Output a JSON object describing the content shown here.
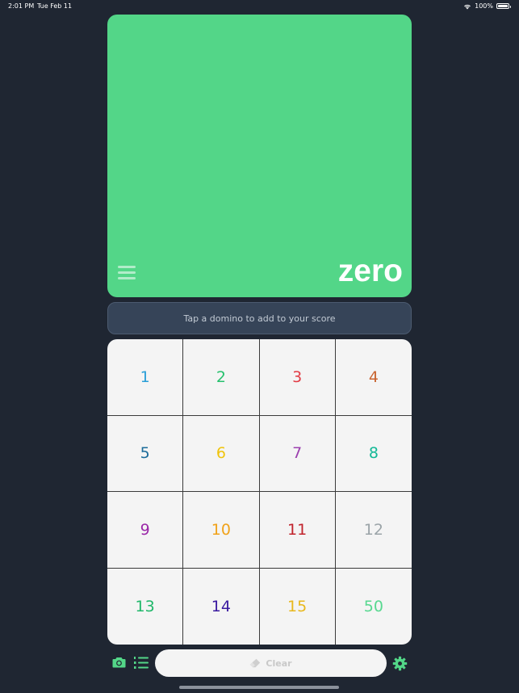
{
  "status_bar": {
    "time": "2:01 PM",
    "date": "Tue Feb 11",
    "battery": "100%"
  },
  "score_card": {
    "score": "zero",
    "background_color": "#53d688"
  },
  "hint": {
    "text": "Tap a domino to add to your score"
  },
  "dominoes": [
    {
      "label": "1",
      "color": "#2a9fd8"
    },
    {
      "label": "2",
      "color": "#27c16e"
    },
    {
      "label": "3",
      "color": "#e23c45"
    },
    {
      "label": "4",
      "color": "#c9632f"
    },
    {
      "label": "5",
      "color": "#1c6c9a"
    },
    {
      "label": "6",
      "color": "#f0c40c"
    },
    {
      "label": "7",
      "color": "#9b3fae"
    },
    {
      "label": "8",
      "color": "#12b896"
    },
    {
      "label": "9",
      "color": "#9a27a8"
    },
    {
      "label": "10",
      "color": "#f0a21a"
    },
    {
      "label": "11",
      "color": "#c1232c"
    },
    {
      "label": "12",
      "color": "#9ba4a8"
    },
    {
      "label": "13",
      "color": "#20b86a"
    },
    {
      "label": "14",
      "color": "#3a1aa0"
    },
    {
      "label": "15",
      "color": "#e8b81c"
    },
    {
      "label": "50",
      "color": "#58d890"
    }
  ],
  "toolbar": {
    "clear_label": "Clear",
    "camera_icon": "camera-icon",
    "list_icon": "numbered-list-icon",
    "settings_icon": "gear-icon",
    "accent_color": "#53d688"
  }
}
